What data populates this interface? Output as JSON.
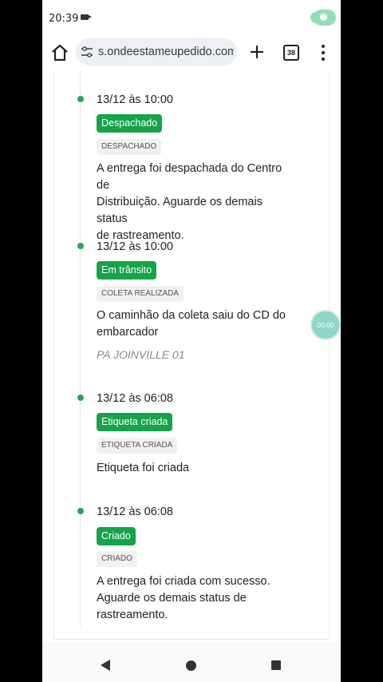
{
  "status_bar": {
    "time": "20:39"
  },
  "browser": {
    "url": "s.ondeestameupedido.com",
    "tab_count": "38"
  },
  "timeline": [
    {
      "date": "13/12 às 10:00",
      "status": "Despachado",
      "code": "DESPACHADO",
      "description": [
        "A entrega foi despachada do Centro de",
        "Distribuição. Aguarde os demais status",
        "de rastreamento."
      ],
      "location": ""
    },
    {
      "date": "13/12 às 10:00",
      "status": "Em trânsito",
      "code": "COLETA REALIZADA",
      "description": [
        "O caminhão da coleta saiu do CD do",
        "embarcador"
      ],
      "location": "PA JOINVILLE 01"
    },
    {
      "date": "13/12 às 06:08",
      "status": "Etiqueta criada",
      "code": "ETIQUETA CRIADA",
      "description": [
        "Etiqueta foi criada"
      ],
      "location": ""
    },
    {
      "date": "13/12 às 06:08",
      "status": "Criado",
      "code": "CRIADO",
      "description": [
        "A entrega foi criada com sucesso.",
        "Aguarde os demais status de",
        "rastreamento."
      ],
      "location": ""
    }
  ],
  "floating_timer": "00:00",
  "colors": {
    "status_badge": "#16a34a",
    "timeline_dot": "#22a85a"
  }
}
